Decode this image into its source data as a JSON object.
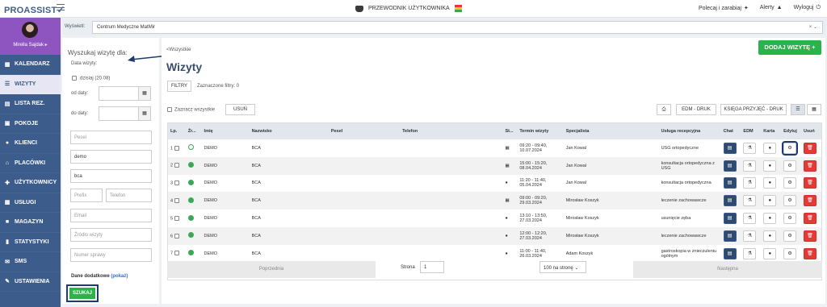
{
  "topbar": {
    "logo": "PROASSIST",
    "guide": "PRZEWODNIK UŻYTKOWNIKA",
    "recommend": "Polecaj i zarabiaj",
    "alerts": "Alerty",
    "logout": "Wyloguj"
  },
  "sidebar": {
    "user": "Mirella Sajdak ▸",
    "items": [
      {
        "label": "KALENDARZ",
        "icon": "calendar-icon"
      },
      {
        "label": "WIZYTY",
        "icon": "list-icon"
      },
      {
        "label": "LISTA REZ.",
        "icon": "book-icon"
      },
      {
        "label": "POKOJE",
        "icon": "door-icon"
      },
      {
        "label": "KLIENCI",
        "icon": "users-icon"
      },
      {
        "label": "PLACÓWKI",
        "icon": "building-icon"
      },
      {
        "label": "UŻYTKOWNICY",
        "icon": "user-add-icon"
      },
      {
        "label": "USŁUGI",
        "icon": "grid-icon"
      },
      {
        "label": "MAGAZYN",
        "icon": "box-icon"
      },
      {
        "label": "STATYSTYKI",
        "icon": "chart-icon"
      },
      {
        "label": "SMS",
        "icon": "sms-icon"
      },
      {
        "label": "USTAWIENIA",
        "icon": "wrench-icon"
      }
    ],
    "active_index": 1
  },
  "filterbar": {
    "label": "Wyświetl:",
    "value": "Centrum Medyczne MatMir"
  },
  "search": {
    "title": "Wyszukaj wizytę dla:",
    "date_label": "Data wizyty:",
    "today_label": "dzisiaj (20.08)",
    "from_label": "od daty:",
    "to_label": "do daty:",
    "pesel_placeholder": "Pesel",
    "surname_value": "demo",
    "name_value": "bca",
    "prefix_placeholder": "Prefix",
    "phone_placeholder": "Telefon",
    "email_placeholder": "Email",
    "source_placeholder": "Źródło wizyty",
    "case_placeholder": "Numer sprawy",
    "extra_label": "Dane dodatkowe",
    "extra_link": "(pokaż)",
    "search_button": "SZUKAJ"
  },
  "main": {
    "back": "<Wszystkie",
    "title": "Wizyty",
    "add_button": "DODAJ WIZYTĘ +",
    "filters_button": "FILTRY",
    "filters_text": "Zaznaczone filtry: 0",
    "select_all": "Zaznacz wszystkie",
    "delete_button": "USUŃ",
    "edm_print": "EDM - DRUK",
    "book_print": "KSIĘGA PRZYJĘĆ - DRUK"
  },
  "table": {
    "headers": [
      "Lp.",
      "Źr...",
      "Imię",
      "Nazwisko",
      "Pesel",
      "Telefon",
      "St...",
      "Termin wizyty",
      "Specjalista",
      "Usługa recepcyjna",
      "Chat",
      "EDM",
      "Karta",
      "Edytuj",
      "Usuń"
    ],
    "rows": [
      {
        "lp": "1",
        "imie": "DEMO",
        "nazwisko": "BCA",
        "status": "calendar",
        "termin": "09:20 - 09:40, 10.07.2024",
        "specjalista": "Jan Kowal",
        "usluga": "USG ortopedyczne"
      },
      {
        "lp": "2",
        "imie": "DEMO",
        "nazwisko": "BCA",
        "status": "calendar",
        "termin": "15:00 - 15:20, 08.04.2024",
        "specjalista": "Jan Kowal",
        "usluga": "konsultacja ortopedyczna z USG"
      },
      {
        "lp": "3",
        "imie": "DEMO",
        "nazwisko": "BCA",
        "status": "person",
        "termin": "11:20 - 11:40, 05.04.2024",
        "specjalista": "Jan Kowal",
        "usluga": "konsultacja ortopedyczna"
      },
      {
        "lp": "4",
        "imie": "DEMO",
        "nazwisko": "BCA",
        "status": "calendar",
        "termin": "09:00 - 09:20, 29.03.2024",
        "specjalista": "Mirosław Koszyk",
        "usluga": "leczenie zachowawcze"
      },
      {
        "lp": "5",
        "imie": "DEMO",
        "nazwisko": "BCA",
        "status": "person",
        "termin": "13:10 - 13:50, 27.03.2024",
        "specjalista": "Mirosław Koszyk",
        "usluga": "usunięcie zęba"
      },
      {
        "lp": "6",
        "imie": "DEMO",
        "nazwisko": "BCA",
        "status": "person",
        "termin": "12:00 - 12:20, 27.03.2024",
        "specjalista": "Mirosław Koszyk",
        "usluga": "leczenie zachowawcze"
      },
      {
        "lp": "7",
        "imie": "DEMO",
        "nazwisko": "BCA",
        "status": "person",
        "termin": "11:00 - 11:40, 26.03.2024",
        "specjalista": "Adam Koszyk",
        "usluga": "gastroskopia w znieczuleniu ogólnym"
      }
    ]
  },
  "pager": {
    "prev": "Poprzednia",
    "page_label": "Strona",
    "page": "1",
    "per_page": "100 na stronę",
    "next": "Następna"
  },
  "colors": {
    "accent_green": "#28b34b",
    "sidebar": "#3c5c8c",
    "profile": "#8e55c0",
    "delete_red": "#e53935"
  }
}
